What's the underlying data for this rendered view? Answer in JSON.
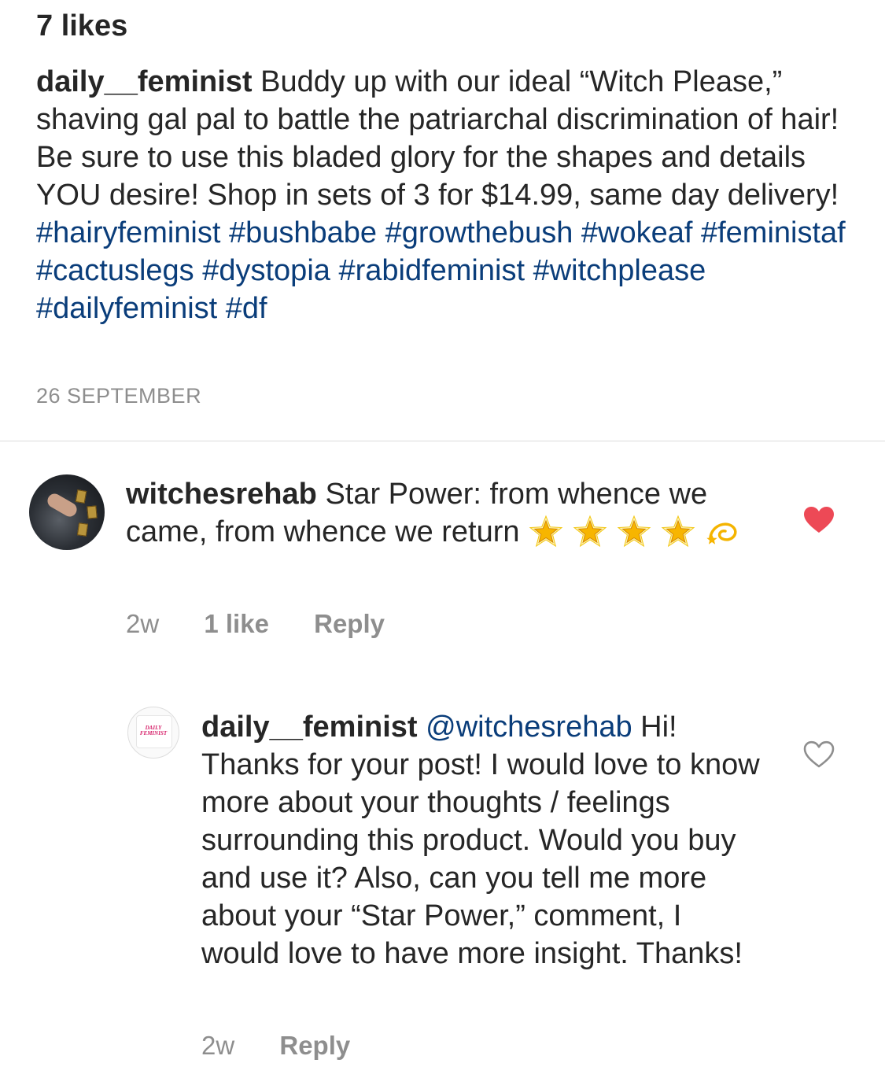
{
  "post": {
    "likes": "7 likes",
    "username": "daily__feminist",
    "caption": "Buddy up with our ideal “Witch Please,” shaving gal pal to battle the patriarchal discrimination of hair! Be sure to use this bladed glory for the shapes and details YOU desire! Shop in sets of 3 for $14.99, same day delivery!",
    "hashtags": "#hairyfeminist #bushbabe #growthebush #wokeaf #feministaf #cactuslegs #dystopia #rabidfeminist #witchplease #dailyfeminist #df",
    "date": "26 SEPTEMBER"
  },
  "comments": [
    {
      "username": "witchesrehab",
      "text": "Star Power: from whence we came, from whence we return",
      "emojis": [
        "glowing-star",
        "glowing-star",
        "glowing-star",
        "glowing-star",
        "dizzy"
      ],
      "time": "2w",
      "likes": "1 like",
      "reply_label": "Reply",
      "liked": true,
      "heart_color": "#ed4956"
    },
    {
      "username": "daily__feminist",
      "mention": "@witchesrehab",
      "text": "Hi! Thanks for your post! I would love to know more about your thoughts / feelings surrounding this product. Would you buy and use it? Also, can you tell me more about your “Star Power,” comment, I would love to have more insight. Thanks!",
      "avatar_text": "DAILY FEMINIST",
      "time": "2w",
      "reply_label": "Reply",
      "liked": false
    }
  ],
  "colors": {
    "text": "#262626",
    "secondary": "#8e8e8e",
    "link": "#0a3d7a",
    "heart": "#ed4956"
  }
}
